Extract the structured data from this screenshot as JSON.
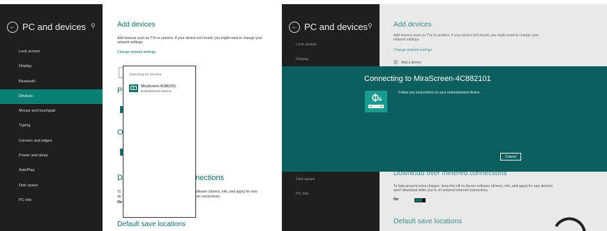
{
  "left": {
    "sidebar": {
      "title": "PC and devices",
      "items": [
        "Lock screen",
        "Display",
        "Bluetooth",
        "Devices",
        "Mouse and touchpad",
        "Typing",
        "Corners and edges",
        "Power and sleep",
        "AutoPlay",
        "Disk space",
        "PC info"
      ],
      "selected": "Devices"
    },
    "main": {
      "heading": "Add devices",
      "description": "Add devices such as TVs or printers. If your device isn't found, you might need to change your network settings.",
      "link": "Change network settings",
      "frag_pr": "Pr",
      "frag_o": "O",
      "frag_do": "Do",
      "frag_connections": "nnections",
      "frag_to": "To",
      "frag_de": "de",
      "frag_on": "On",
      "frag_software": "e software (drivers, info, and apps) for new",
      "frag_internet": "ternet connections.",
      "default_heading": "Default save locations"
    },
    "popup": {
      "title": "Searching for devices",
      "device_name": "MiraScreen-4C882101",
      "device_type": "Entertainment device"
    }
  },
  "right": {
    "sidebar": {
      "title": "PC and devices",
      "items_top": [
        "Lock screen",
        "Display"
      ],
      "items_bottom": [
        "Disk space",
        "PC info"
      ]
    },
    "main": {
      "heading": "Add devices",
      "description": "Add devices such as TVs or printers. If your device isn't found, you might need to change your network settings.",
      "link": "Change network settings",
      "add_device": "Add a device",
      "metered_heading": "Download over metered connections",
      "metered_desc": "To help prevent extra charges, keep this off so device software (drivers, info, and apps) for new devices won't download while you're on metered Internet connections.",
      "toggle_label": "On",
      "default_heading": "Default save locations"
    },
    "dialog": {
      "title": "Connecting to MiraScreen-4C882101",
      "message": "Follow any instructions on your entertainment device.",
      "cancel": "Cancel"
    }
  }
}
